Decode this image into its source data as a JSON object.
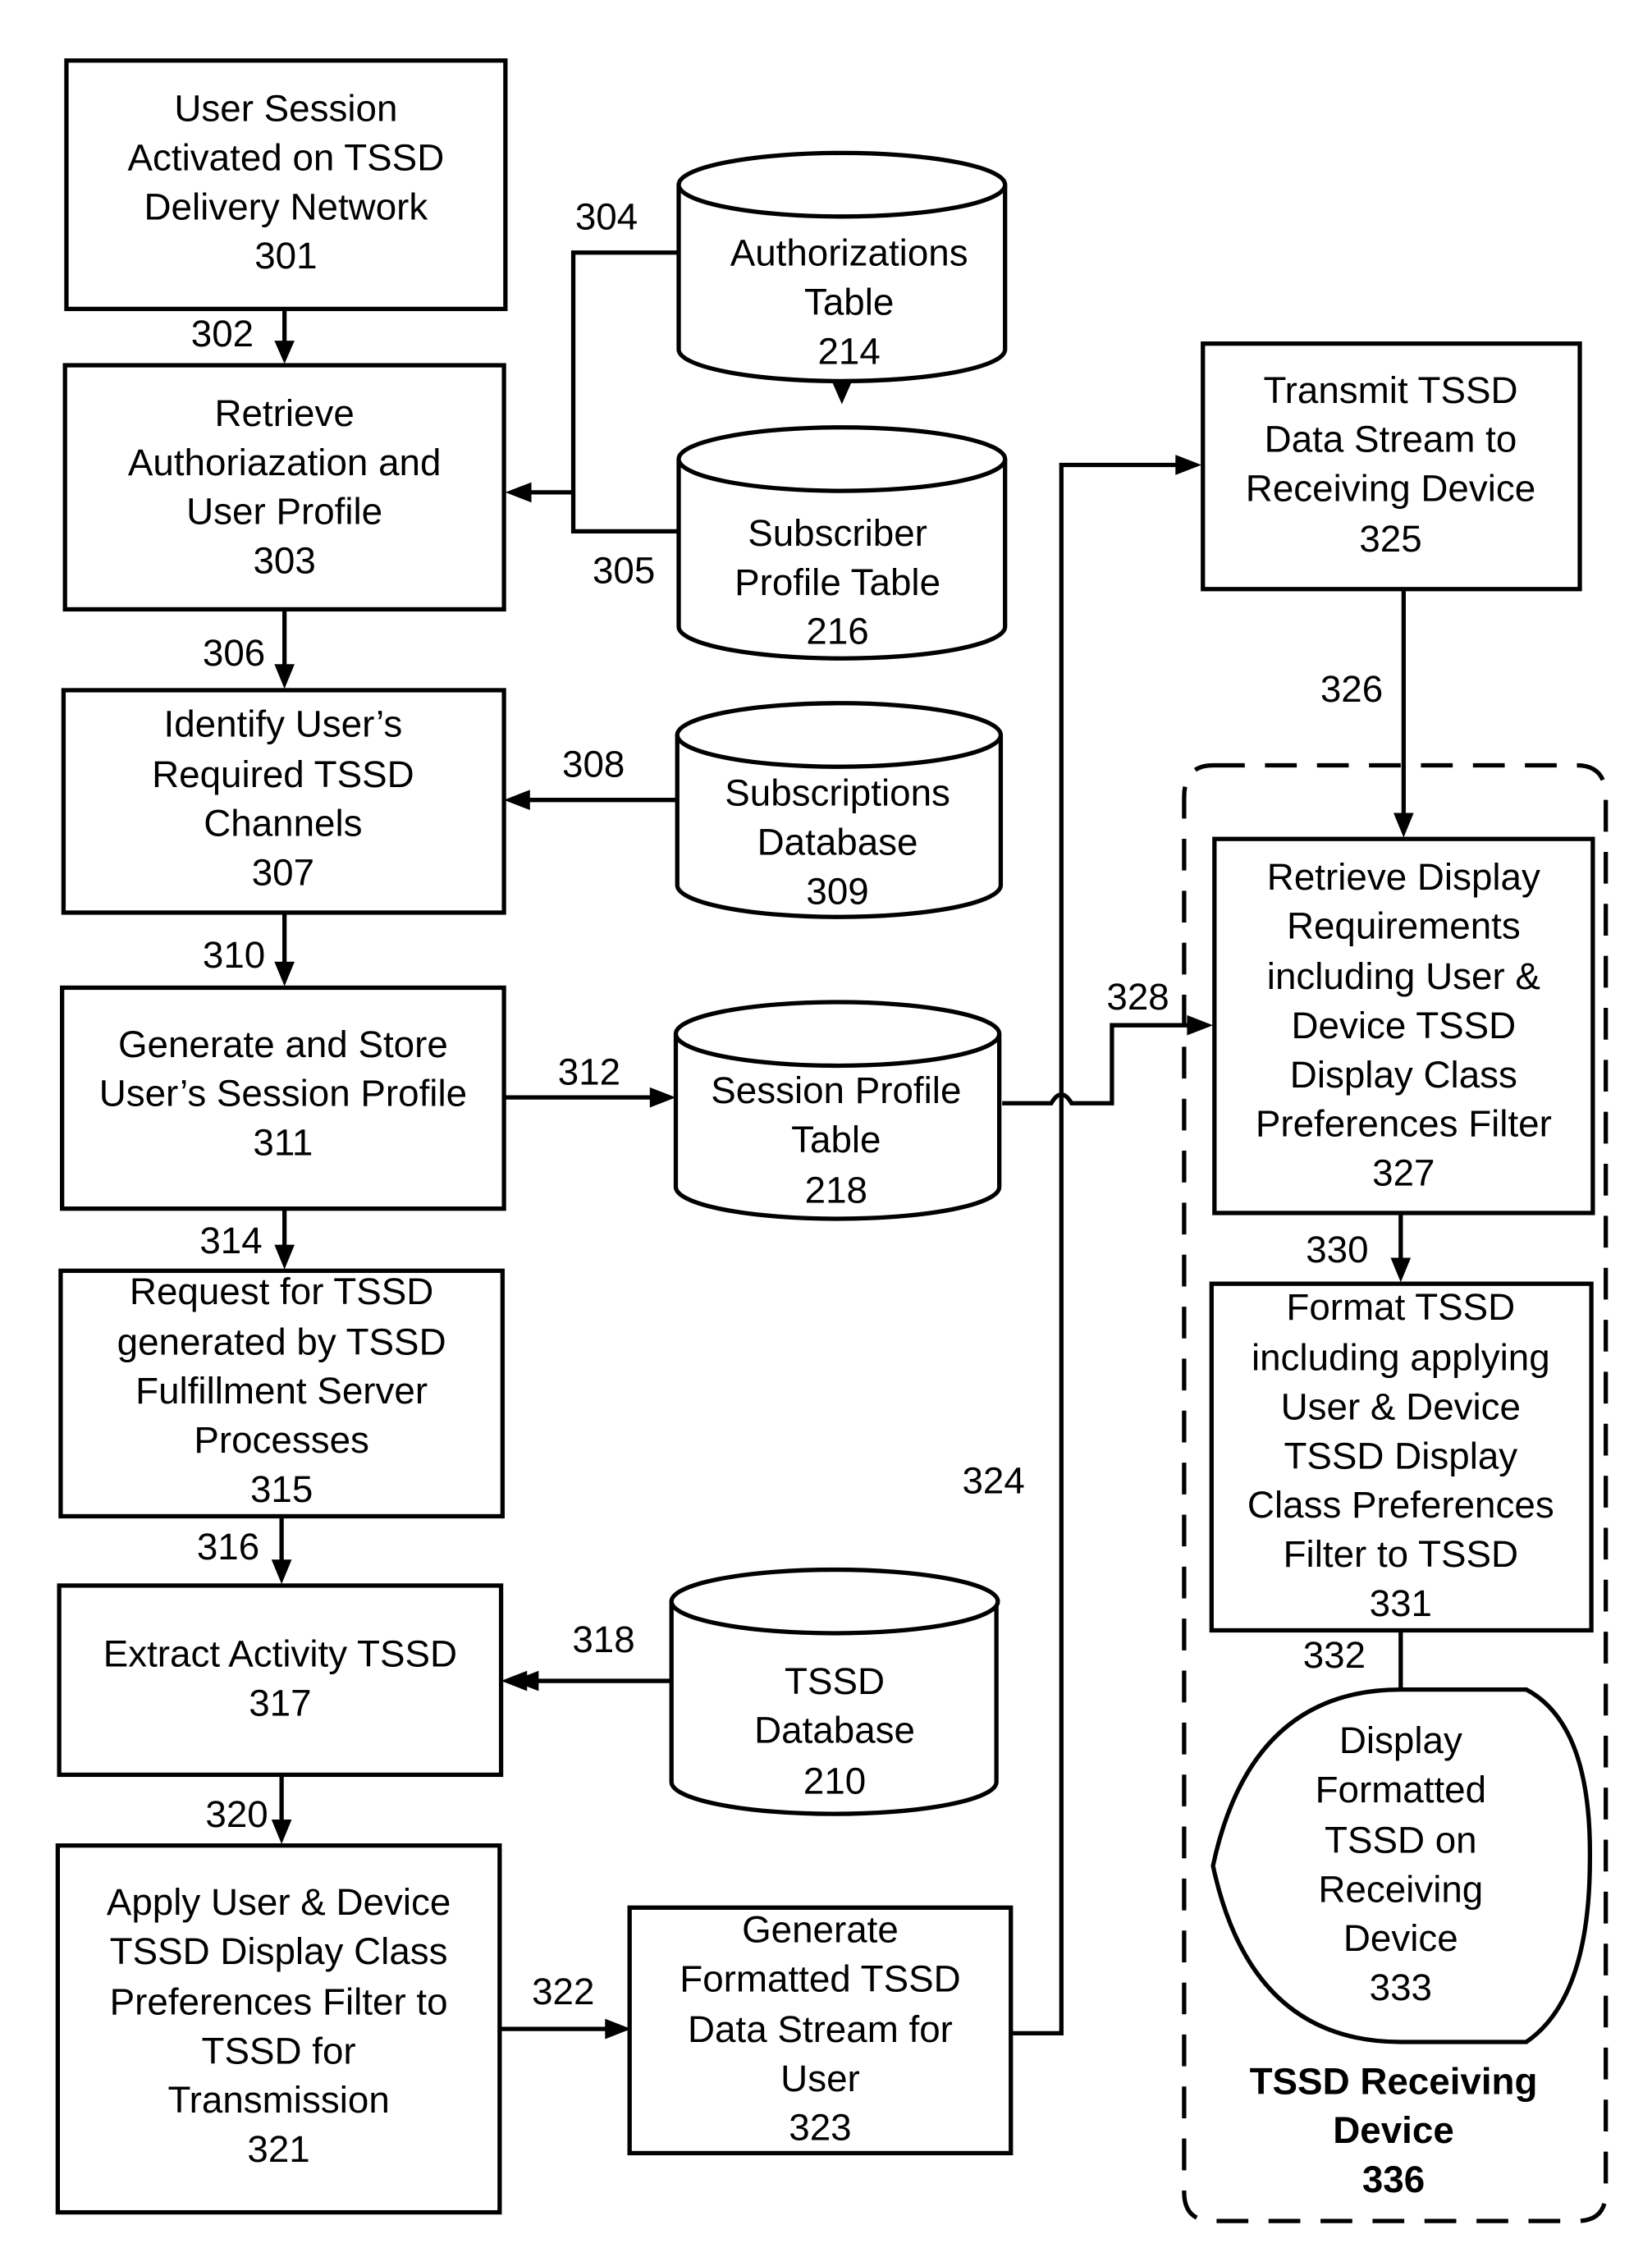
{
  "diagram": {
    "nodes": [
      {
        "id": "301",
        "kind": "process",
        "lines": [
          "User Session",
          "Activated on TSSD",
          "Delivery Network",
          "301"
        ]
      },
      {
        "id": "303",
        "kind": "process",
        "lines": [
          "Retrieve",
          "Authoriazation and",
          "User  Profile",
          "303"
        ]
      },
      {
        "id": "307",
        "kind": "process",
        "lines": [
          "Identify User’s",
          "Required TSSD",
          "Channels",
          "307"
        ]
      },
      {
        "id": "311",
        "kind": "process",
        "lines": [
          "Generate and Store",
          "User’s Session Profile",
          "311"
        ]
      },
      {
        "id": "315",
        "kind": "process",
        "lines": [
          "Request for TSSD",
          "generated by TSSD",
          "Fulfillment Server",
          "Processes",
          "315"
        ]
      },
      {
        "id": "317",
        "kind": "process",
        "lines": [
          "Extract Activity TSSD",
          "317"
        ]
      },
      {
        "id": "321",
        "kind": "process",
        "lines": [
          "Apply User & Device",
          "TSSD Display Class",
          "Preferences Filter to",
          "TSSD for",
          "Transmission",
          "321"
        ]
      },
      {
        "id": "323",
        "kind": "process",
        "lines": [
          "Generate",
          "Formatted TSSD",
          "Data Stream for",
          "User",
          "323"
        ]
      },
      {
        "id": "325",
        "kind": "process",
        "lines": [
          "Transmit TSSD",
          "Data Stream to",
          "Receiving Device",
          "325"
        ]
      },
      {
        "id": "327",
        "kind": "process",
        "lines": [
          "Retrieve Display",
          "Requirements",
          "including User &",
          "Device TSSD",
          "Display Class",
          "Preferences Filter",
          "327"
        ]
      },
      {
        "id": "331",
        "kind": "process",
        "lines": [
          "Format TSSD",
          "including applying",
          "User & Device",
          "TSSD Display",
          "Class Preferences",
          "Filter to TSSD",
          "331"
        ]
      },
      {
        "id": "333",
        "kind": "display",
        "lines": [
          "Display",
          "Formatted",
          "TSSD on",
          "Receiving",
          "Device",
          "333"
        ]
      },
      {
        "id": "214",
        "kind": "database",
        "lines": [
          "Authorizations",
          "Table",
          "214"
        ]
      },
      {
        "id": "216",
        "kind": "database",
        "lines": [
          "Subscriber",
          "Profile Table",
          "216"
        ]
      },
      {
        "id": "309",
        "kind": "database",
        "lines": [
          "Subscriptions",
          "Database",
          "309"
        ]
      },
      {
        "id": "218",
        "kind": "database",
        "lines": [
          "Session Profile",
          "Table",
          "218"
        ]
      },
      {
        "id": "210",
        "kind": "database",
        "lines": [
          "TSSD",
          "Database",
          "210"
        ]
      }
    ],
    "group": {
      "lines": [
        "TSSD Receiving",
        "Device",
        "336"
      ]
    },
    "edge_labels": [
      "302",
      "304",
      "305",
      "306",
      "308",
      "310",
      "312",
      "314",
      "316",
      "318",
      "320",
      "322",
      "324",
      "326",
      "328",
      "330",
      "332"
    ]
  }
}
